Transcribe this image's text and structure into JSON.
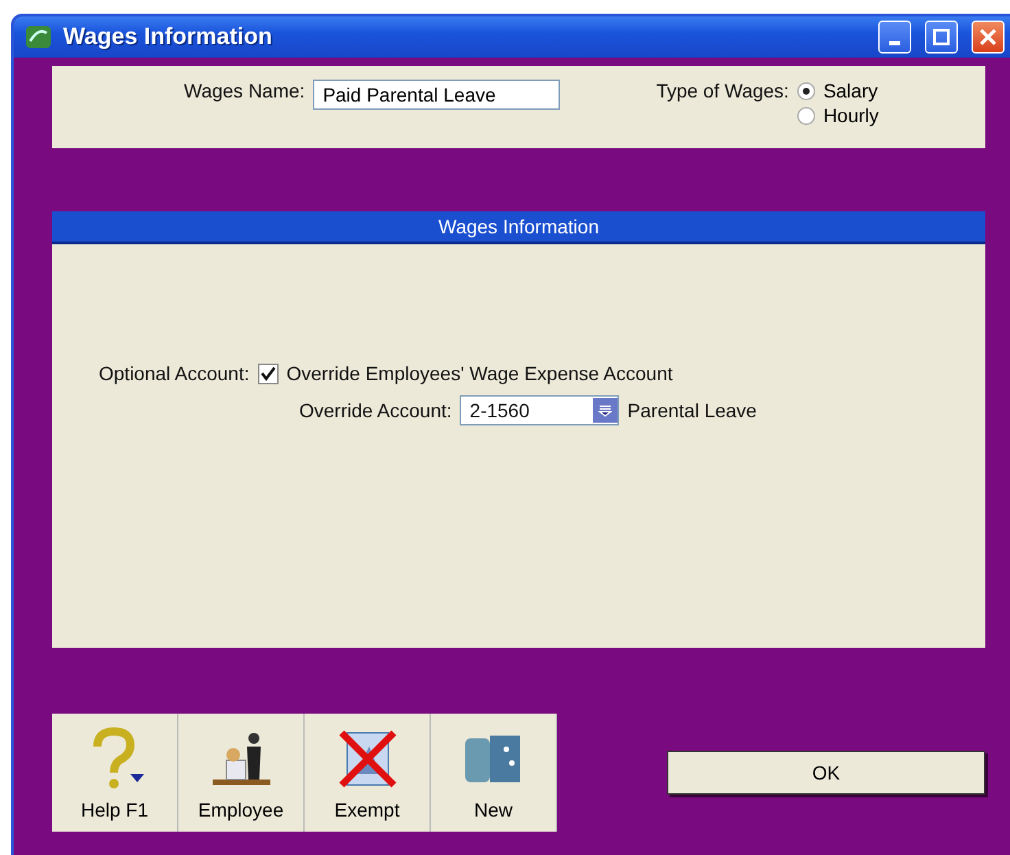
{
  "window": {
    "title": "Wages Information"
  },
  "wages_name": {
    "label": "Wages Name:",
    "value": "Paid Parental Leave"
  },
  "type_of_wages": {
    "label": "Type of Wages:",
    "options": [
      {
        "label": "Salary",
        "selected": true
      },
      {
        "label": "Hourly",
        "selected": false
      }
    ]
  },
  "section": {
    "title": "Wages Information"
  },
  "optional_account": {
    "label": "Optional Account:",
    "checkbox": {
      "label": "Override Employees' Wage Expense Account",
      "checked": true
    }
  },
  "override_account": {
    "label": "Override Account:",
    "value": "2-1560",
    "account_name": "Parental Leave"
  },
  "toolbar": [
    {
      "label": "Help F1",
      "kind": "help"
    },
    {
      "label": "Employee",
      "kind": "employee"
    },
    {
      "label": "Exempt",
      "kind": "exempt"
    },
    {
      "label": "New",
      "kind": "new"
    }
  ],
  "ok_button": {
    "label": "OK"
  }
}
